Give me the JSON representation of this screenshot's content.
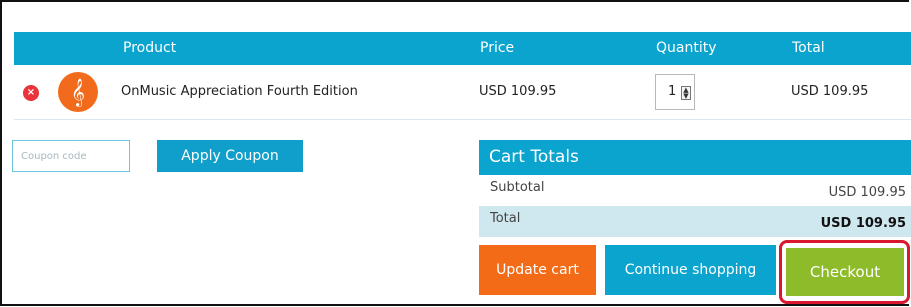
{
  "cart": {
    "headers": {
      "product": "Product",
      "price": "Price",
      "quantity": "Quantity",
      "total": "Total"
    },
    "items": [
      {
        "remove_icon": "remove-icon",
        "thumbnail_icon": "treble-clef-icon",
        "product_name": "OnMusic Appreciation Fourth Edition",
        "price": "USD 109.95",
        "quantity": "1",
        "total": "USD 109.95"
      }
    ]
  },
  "coupon": {
    "placeholder": "Coupon code",
    "apply_label": "Apply Coupon"
  },
  "totals": {
    "title": "Cart Totals",
    "subtotal_label": "Subtotal",
    "subtotal_value": "USD 109.95",
    "total_label": "Total",
    "total_value": "USD 109.95"
  },
  "actions": {
    "update_cart": "Update cart",
    "continue_shopping": "Continue shopping",
    "checkout": "Checkout"
  },
  "colors": {
    "primary_blue": "#0ba4cf",
    "orange": "#f36b16",
    "green": "#8ebb2a",
    "highlight_red": "#d9182d",
    "total_row": "#cfe8f0"
  }
}
